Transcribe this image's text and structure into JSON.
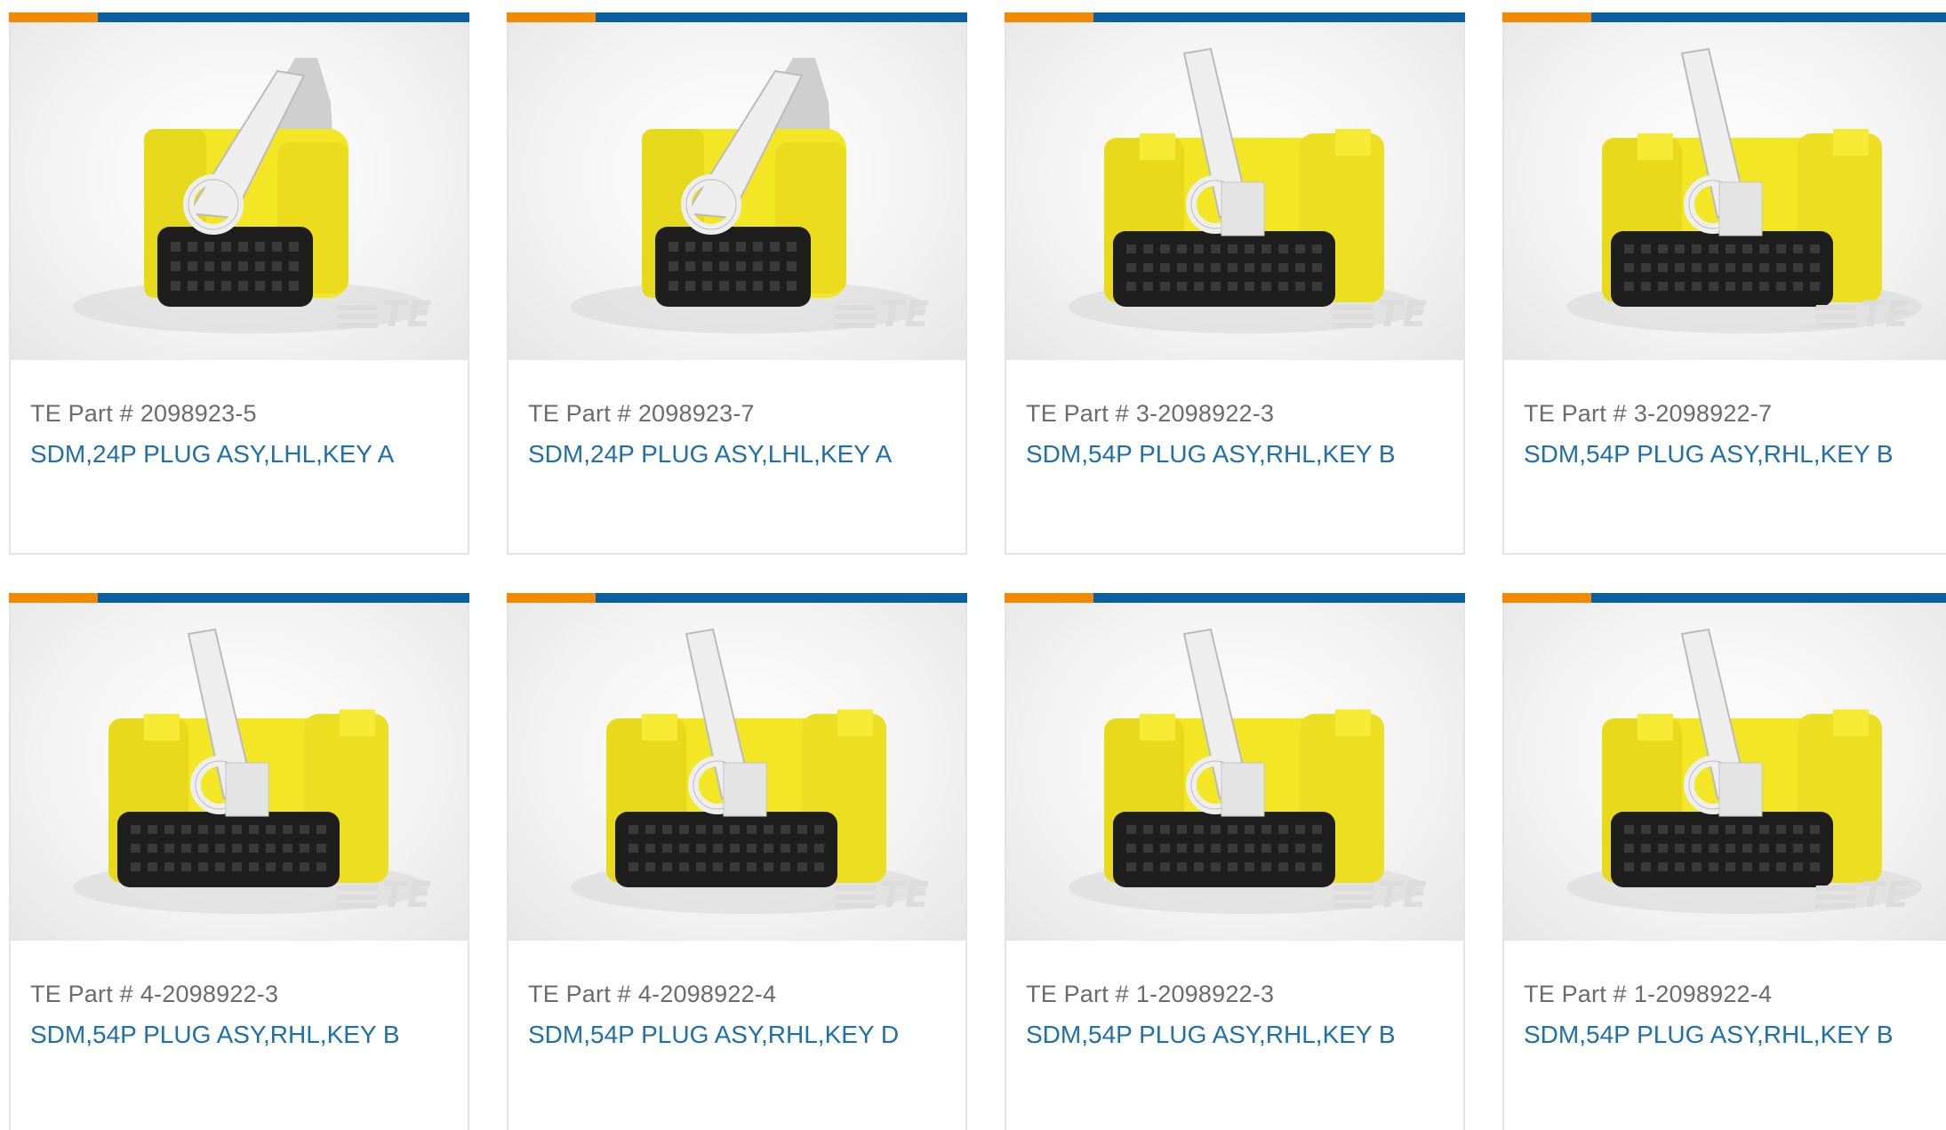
{
  "products": [
    {
      "part_prefix": "TE Part #",
      "part_number": "2098923-5",
      "description": "SDM,24P PLUG ASY,LHL,KEY A",
      "variant": "24p",
      "logo": "TE"
    },
    {
      "part_prefix": "TE Part #",
      "part_number": "2098923-7",
      "description": "SDM,24P PLUG ASY,LHL,KEY A",
      "variant": "24p",
      "logo": "TE"
    },
    {
      "part_prefix": "TE Part #",
      "part_number": "3-2098922-3",
      "description": "SDM,54P PLUG ASY,RHL,KEY B",
      "variant": "54p",
      "logo": "TE"
    },
    {
      "part_prefix": "TE Part #",
      "part_number": "3-2098922-7",
      "description": "SDM,54P PLUG ASY,RHL,KEY B",
      "variant": "54p",
      "logo": "TE"
    },
    {
      "part_prefix": "TE Part #",
      "part_number": "4-2098922-3",
      "description": "SDM,54P PLUG ASY,RHL,KEY B",
      "variant": "54p",
      "logo": "TE"
    },
    {
      "part_prefix": "TE Part #",
      "part_number": "4-2098922-4",
      "description": "SDM,54P PLUG ASY,RHL,KEY D",
      "variant": "54p",
      "logo": "TE"
    },
    {
      "part_prefix": "TE Part #",
      "part_number": "1-2098922-3",
      "description": "SDM,54P PLUG ASY,RHL,KEY B",
      "variant": "54p",
      "logo": "TE"
    },
    {
      "part_prefix": "TE Part #",
      "part_number": "1-2098922-4",
      "description": "SDM,54P PLUG ASY,RHL,KEY B",
      "variant": "54p",
      "logo": "TE"
    }
  ],
  "colors": {
    "accent_orange": "#f28a00",
    "accent_blue": "#0b60a0",
    "part_text": "#6b6b6b",
    "link_text": "#1f6fa8",
    "connector_yellow": "#f3e624",
    "connector_black": "#1e1e1e",
    "latch_white": "#eeeeee"
  }
}
